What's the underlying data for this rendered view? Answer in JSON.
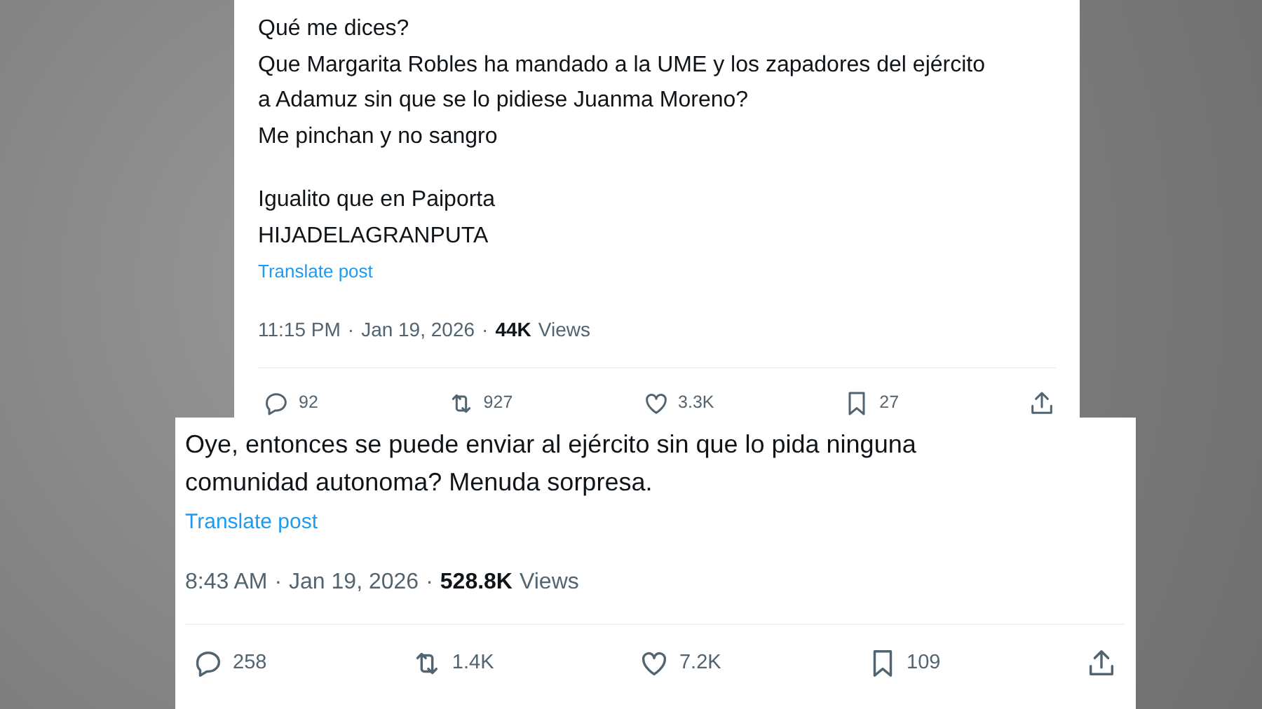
{
  "posts": [
    {
      "paragraphs": [
        [
          "Qué me dices?",
          "Que Margarita Robles ha mandado a la UME y los zapadores del ejército",
          "a Adamuz sin que se lo pidiese Juanma Moreno?",
          "Me pinchan y no sangro"
        ],
        [
          "Igualito que en Paiporta",
          "HIJADELAGRANPUTA"
        ]
      ],
      "translate": "Translate post",
      "meta": [
        "11:15 PM",
        "·",
        "Jan 19, 2026",
        "·"
      ],
      "views": "44K",
      "views_label": "Views",
      "actions": [
        {
          "kind": "reply",
          "count": "92"
        },
        {
          "kind": "repost",
          "count": "927"
        },
        {
          "kind": "like",
          "count": "3.3K"
        },
        {
          "kind": "bookmark",
          "count": "27"
        },
        {
          "kind": "share"
        }
      ]
    },
    {
      "paragraphs": [
        [
          "Oye, entonces se puede enviar al ejército sin que lo pida ninguna",
          "comunidad autonoma? Menuda sorpresa."
        ]
      ],
      "translate": "Translate post",
      "meta": [
        "8:43 AM",
        "·",
        "Jan 19, 2026",
        "·"
      ],
      "views": "528.8K",
      "views_label": "Views",
      "actions": [
        {
          "kind": "reply",
          "count": "258"
        },
        {
          "kind": "repost",
          "count": "1.4K"
        },
        {
          "kind": "like",
          "count": "7.2K"
        },
        {
          "kind": "bookmark",
          "count": "109"
        },
        {
          "kind": "share"
        }
      ]
    }
  ]
}
